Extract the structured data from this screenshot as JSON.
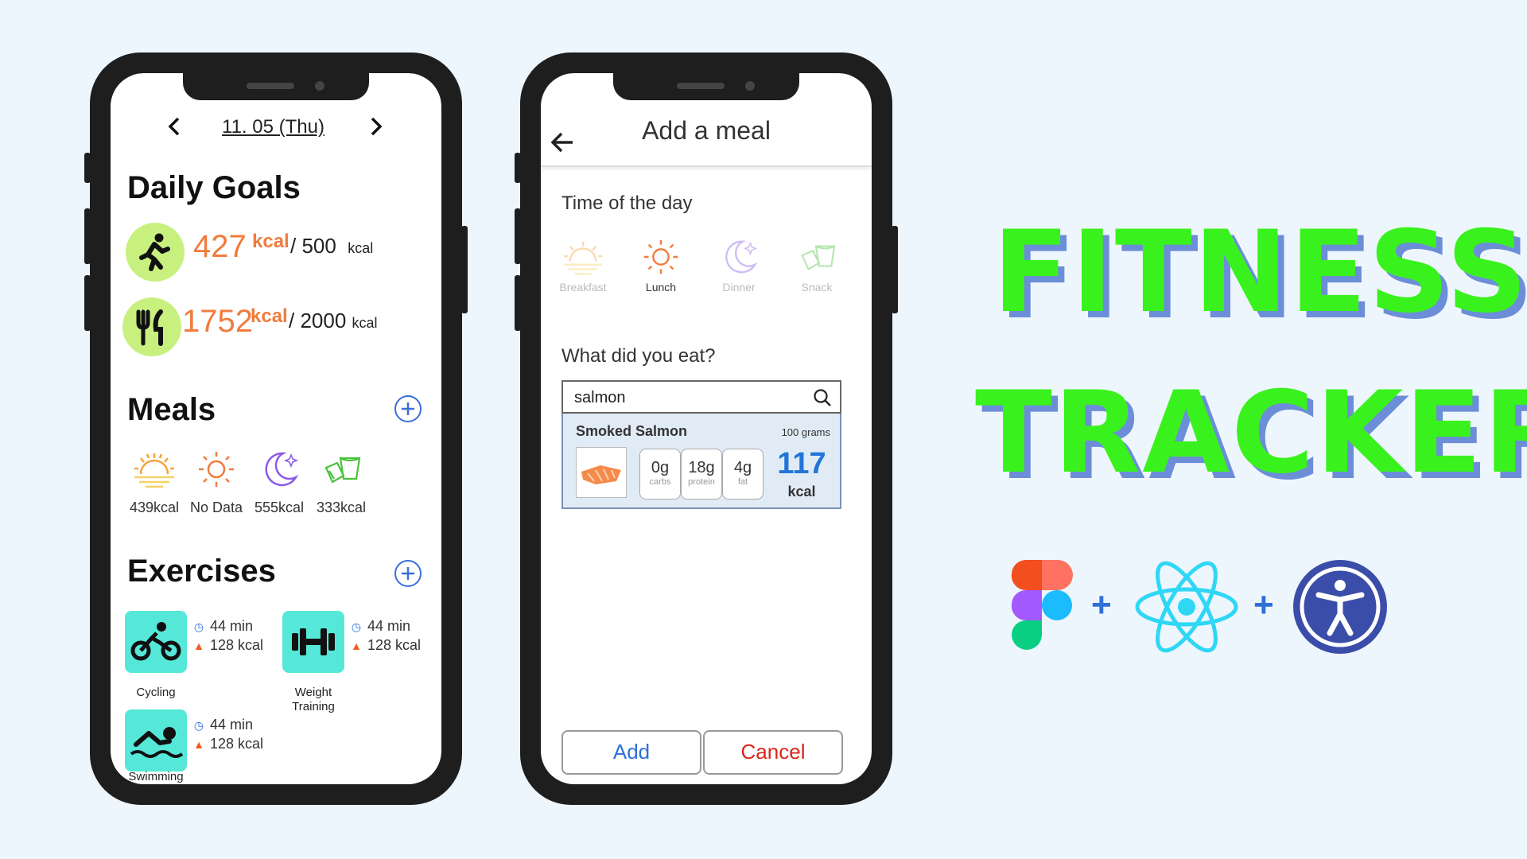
{
  "phone1": {
    "date": "11. 05 (Thu)",
    "daily_goals_title": "Daily Goals",
    "activity": {
      "value": "427",
      "unit": "kcal",
      "goal": "/ 500",
      "goal_unit": "kcal"
    },
    "food": {
      "value": "1752",
      "unit": "kcal",
      "goal": "/ 2000",
      "goal_unit": "kcal"
    },
    "meals_title": "Meals",
    "meals": [
      {
        "icon": "sunrise-icon",
        "label": "439kcal"
      },
      {
        "icon": "sun-icon",
        "label": "No Data"
      },
      {
        "icon": "moon-icon",
        "label": "555kcal"
      },
      {
        "icon": "snack-icon",
        "label": "333kcal"
      }
    ],
    "exercises_title": "Exercises",
    "exercises": [
      {
        "icon": "cycling-icon",
        "name": "Cycling",
        "duration": "44 min",
        "calories": "128 kcal"
      },
      {
        "icon": "dumbbell-icon",
        "name": "Weight Training",
        "duration": "44 min",
        "calories": "128 kcal"
      },
      {
        "icon": "swimming-icon",
        "name": "Swimming",
        "duration": "44 min",
        "calories": "128 kcal"
      }
    ]
  },
  "phone2": {
    "title": "Add a meal",
    "time_of_day_label": "Time of the day",
    "times": [
      {
        "label": "Breakfast",
        "selected": false
      },
      {
        "label": "Lunch",
        "selected": true
      },
      {
        "label": "Dinner",
        "selected": false
      },
      {
        "label": "Snack",
        "selected": false
      }
    ],
    "what_eat_label": "What did you eat?",
    "search_value": "salmon",
    "result": {
      "name": "Smoked Salmon",
      "amount": "100 grams",
      "macros": [
        {
          "value": "0g",
          "label": "carbs"
        },
        {
          "value": "18g",
          "label": "protein"
        },
        {
          "value": "4g",
          "label": "fat"
        }
      ],
      "kcal_value": "117",
      "kcal_unit": "kcal"
    },
    "add_label": "Add",
    "cancel_label": "Cancel"
  },
  "brand": {
    "line1": "FITNESS",
    "line2": "TRACKER",
    "plus1": "+",
    "plus2": "+",
    "tools": [
      "figma-logo-icon",
      "react-logo-icon",
      "accessibility-icon"
    ]
  },
  "colors": {
    "accent_orange": "#f07c3d",
    "goal_green": "#c8f07f",
    "exercise_teal": "#55e8d8",
    "brand_green": "#39f21d",
    "link_blue": "#3a6fd8",
    "cancel_red": "#d9261c",
    "background": "#eef6fd"
  }
}
